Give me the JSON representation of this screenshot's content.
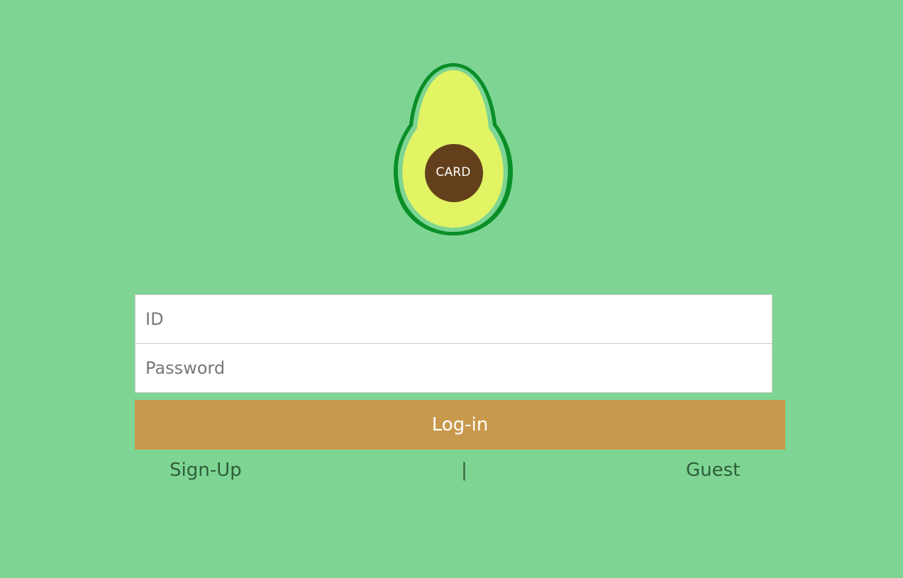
{
  "logo": {
    "label": "CARD",
    "colors": {
      "skin": "#0a8f28",
      "ring": "#7ed593",
      "flesh": "#e2f364",
      "pit": "#63401b"
    }
  },
  "login_form": {
    "id_placeholder": "ID",
    "password_placeholder": "Password",
    "login_label": "Log-in"
  },
  "links": {
    "signup_label": "Sign-Up",
    "separator": "|",
    "guest_label": "Guest"
  },
  "theme": {
    "background": "#7ed593",
    "button": "#c8994d",
    "link_text": "#2f5d3a"
  }
}
